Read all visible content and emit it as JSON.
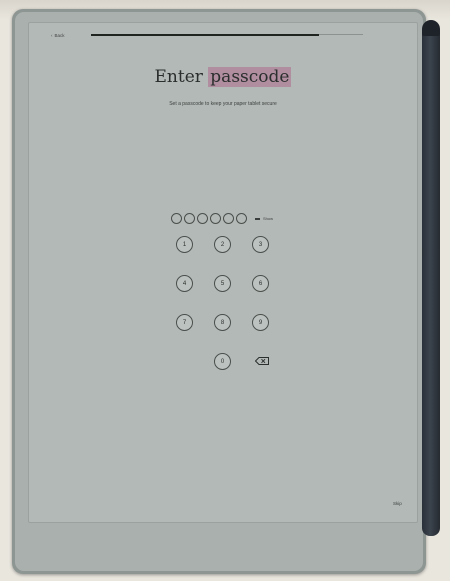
{
  "header": {
    "back_label": "Back"
  },
  "main": {
    "title_plain": "Enter ",
    "title_highlight": "passcode",
    "subtitle": "Set a passcode to keep your paper tablet secure"
  },
  "passcode": {
    "length": 6,
    "show_label": "Show"
  },
  "keypad": {
    "keys": [
      "1",
      "2",
      "3",
      "4",
      "5",
      "6",
      "7",
      "8",
      "9",
      "0"
    ],
    "delete_icon": "backspace-icon"
  },
  "footer": {
    "skip_label": "Skip"
  },
  "colors": {
    "highlight": "#b08ea0",
    "screen": "#b3b9b6",
    "stylus": "#2f353d"
  }
}
